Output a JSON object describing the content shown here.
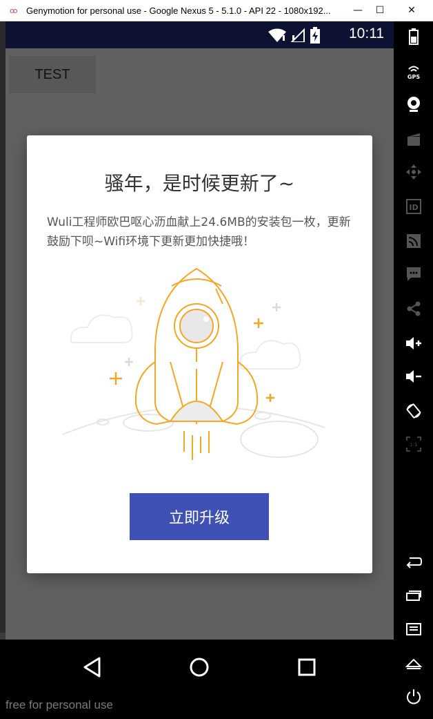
{
  "window": {
    "title": "Genymotion for personal use - Google Nexus 5 - 5.1.0 - API 22 - 1080x192...",
    "minimize": "—",
    "maximize": "☐",
    "close": "✕"
  },
  "statusbar": {
    "time": "10:11"
  },
  "app": {
    "test_button": "TEST"
  },
  "dialog": {
    "title": "骚年，是时候更新了~",
    "message": "Wuli工程师欧巴呕心沥血献上24.6MB的安装包一枚，更新鼓励下呗~Wifi环境下更新更加快捷哦！",
    "upgrade_button": "立即升级"
  },
  "watermark": "free for personal use",
  "colors": {
    "primary": "#3f51b5",
    "rocket": "#f5a623",
    "scrim": "#616161"
  },
  "sidebar": {
    "tools": [
      "battery-icon",
      "gps-icon",
      "webcam-icon",
      "screencast-icon",
      "dpad-icon",
      "device-id-icon",
      "network-icon",
      "sms-icon",
      "share-icon",
      "volume-up-icon",
      "volume-down-icon",
      "rotate-icon",
      "pixel-perfect-icon",
      "back-icon",
      "recent-apps-icon",
      "menu-icon",
      "home-icon",
      "power-icon"
    ]
  }
}
